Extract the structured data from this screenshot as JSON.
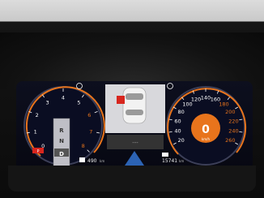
{
  "tachometer": {
    "ticks": [
      "0",
      "1",
      "2",
      "3",
      "4",
      "5",
      "6",
      "7",
      "8"
    ],
    "gear_options": [
      "R",
      "N",
      "D"
    ],
    "selected_gear": "D",
    "drive_mode": "P"
  },
  "speedometer": {
    "ticks": [
      "20",
      "40",
      "60",
      "80",
      "100",
      "120",
      "140",
      "160",
      "180",
      "200",
      "220",
      "240",
      "260"
    ],
    "speed_value": "0",
    "unit": "km/h"
  },
  "center": {
    "blurred_label": "---"
  },
  "footer": {
    "range_value": "490",
    "range_unit": "km",
    "odometer_value": "15741",
    "odometer_unit": "km"
  },
  "colors": {
    "accent_orange": "#e8741c",
    "red": "#d7261e",
    "screen_bg": "#0b0d1a"
  }
}
